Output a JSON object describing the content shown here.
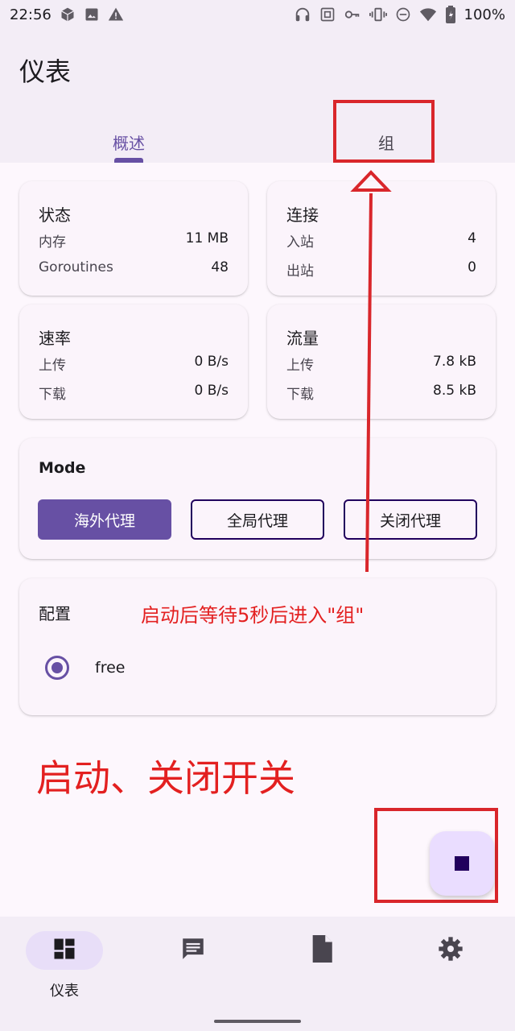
{
  "status_bar": {
    "time": "22:56",
    "battery": "100%",
    "icons": [
      "cube-icon",
      "image-icon",
      "warning-icon",
      "headset-icon",
      "nfc-icon",
      "key-icon",
      "vibrate-icon",
      "dnd-icon",
      "wifi-icon",
      "battery-icon"
    ]
  },
  "app_bar": {
    "title": "仪表",
    "tabs": [
      {
        "label": "概述",
        "selected": true
      },
      {
        "label": "组",
        "selected": false
      }
    ]
  },
  "status_card": {
    "title": "状态",
    "rows": [
      {
        "label": "内存",
        "value": "11 MB"
      },
      {
        "label": "Goroutines",
        "value": "48"
      }
    ]
  },
  "connection_card": {
    "title": "连接",
    "rows": [
      {
        "label": "入站",
        "value": "4"
      },
      {
        "label": "出站",
        "value": "0"
      }
    ]
  },
  "speed_card": {
    "title": "速率",
    "rows": [
      {
        "label": "上传",
        "value": "0 B/s"
      },
      {
        "label": "下载",
        "value": "0 B/s"
      }
    ]
  },
  "traffic_card": {
    "title": "流量",
    "rows": [
      {
        "label": "上传",
        "value": "7.8 kB"
      },
      {
        "label": "下载",
        "value": "8.5 kB"
      }
    ]
  },
  "mode_card": {
    "title": "Mode",
    "buttons": [
      {
        "label": "海外代理",
        "active": true
      },
      {
        "label": "全局代理",
        "active": false
      },
      {
        "label": "关闭代理",
        "active": false
      }
    ]
  },
  "profile_card": {
    "title": "配置",
    "profile": "free",
    "selected": true
  },
  "annotations": {
    "note_groups": "启动后等待5秒后进入\"组\"",
    "note_switch": "启动、关闭开关",
    "color": "#e32020"
  },
  "fab": {
    "icon": "stop-icon",
    "color": "#eaddff"
  },
  "bottom_nav": {
    "items": [
      {
        "label": "仪表",
        "icon": "dashboard-icon",
        "selected": true
      },
      {
        "label": "",
        "icon": "message-icon",
        "selected": false
      },
      {
        "label": "",
        "icon": "document-icon",
        "selected": false
      },
      {
        "label": "",
        "icon": "gear-icon",
        "selected": false
      }
    ]
  },
  "colors": {
    "primary": "#6750a4",
    "surface": "#fdf7fd",
    "annotation_red": "#d9262b"
  }
}
